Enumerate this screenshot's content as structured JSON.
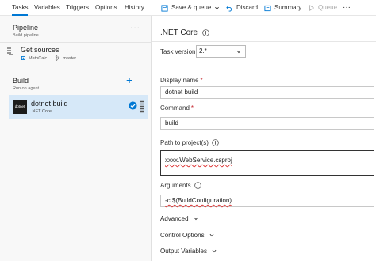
{
  "tabs": [
    "Tasks",
    "Variables",
    "Triggers",
    "Options",
    "History"
  ],
  "toolbar": {
    "save_queue": "Save & queue",
    "discard": "Discard",
    "summary": "Summary",
    "queue": "Queue",
    "more": "···"
  },
  "pipeline": {
    "title": "Pipeline",
    "subtitle": "Build pipeline",
    "more": "···"
  },
  "get_sources": {
    "title": "Get sources",
    "repo": "MathCalc",
    "branch": "master"
  },
  "phase": {
    "title": "Build",
    "subtitle": "Run on agent",
    "add": "+"
  },
  "task": {
    "icon_text": "dotnet",
    "title": "dotnet build",
    "subtitle": ".NET Core"
  },
  "details": {
    "title": ".NET Core",
    "task_version_label": "Task version",
    "task_version_value": "2.*",
    "display_name_label": "Display name",
    "display_name_value": "dotnet build",
    "command_label": "Command",
    "command_value": "build",
    "path_label": "Path to project(s)",
    "path_value": "xxxx.WebService.csproj",
    "arguments_label": "Arguments",
    "arguments_value": "-c $(BuildConfiguration)",
    "required_mark": "*",
    "advanced": "Advanced",
    "control_options": "Control Options",
    "output_variables": "Output Variables"
  },
  "colors": {
    "accent": "#0078d4",
    "selected_row": "#d6e8f8",
    "required": "#c4262e"
  }
}
